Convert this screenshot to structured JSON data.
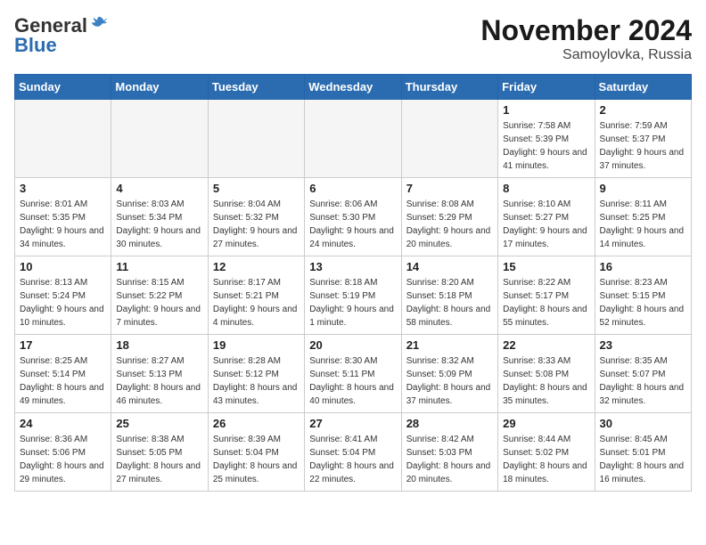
{
  "header": {
    "logo_general": "General",
    "logo_blue": "Blue",
    "month_title": "November 2024",
    "location": "Samoylovka, Russia"
  },
  "weekdays": [
    "Sunday",
    "Monday",
    "Tuesday",
    "Wednesday",
    "Thursday",
    "Friday",
    "Saturday"
  ],
  "weeks": [
    [
      {
        "day": "",
        "empty": true
      },
      {
        "day": "",
        "empty": true
      },
      {
        "day": "",
        "empty": true
      },
      {
        "day": "",
        "empty": true
      },
      {
        "day": "",
        "empty": true
      },
      {
        "day": "1",
        "sunrise": "7:58 AM",
        "sunset": "5:39 PM",
        "daylight": "9 hours and 41 minutes."
      },
      {
        "day": "2",
        "sunrise": "7:59 AM",
        "sunset": "5:37 PM",
        "daylight": "9 hours and 37 minutes."
      }
    ],
    [
      {
        "day": "3",
        "sunrise": "8:01 AM",
        "sunset": "5:35 PM",
        "daylight": "9 hours and 34 minutes."
      },
      {
        "day": "4",
        "sunrise": "8:03 AM",
        "sunset": "5:34 PM",
        "daylight": "9 hours and 30 minutes."
      },
      {
        "day": "5",
        "sunrise": "8:04 AM",
        "sunset": "5:32 PM",
        "daylight": "9 hours and 27 minutes."
      },
      {
        "day": "6",
        "sunrise": "8:06 AM",
        "sunset": "5:30 PM",
        "daylight": "9 hours and 24 minutes."
      },
      {
        "day": "7",
        "sunrise": "8:08 AM",
        "sunset": "5:29 PM",
        "daylight": "9 hours and 20 minutes."
      },
      {
        "day": "8",
        "sunrise": "8:10 AM",
        "sunset": "5:27 PM",
        "daylight": "9 hours and 17 minutes."
      },
      {
        "day": "9",
        "sunrise": "8:11 AM",
        "sunset": "5:25 PM",
        "daylight": "9 hours and 14 minutes."
      }
    ],
    [
      {
        "day": "10",
        "sunrise": "8:13 AM",
        "sunset": "5:24 PM",
        "daylight": "9 hours and 10 minutes."
      },
      {
        "day": "11",
        "sunrise": "8:15 AM",
        "sunset": "5:22 PM",
        "daylight": "9 hours and 7 minutes."
      },
      {
        "day": "12",
        "sunrise": "8:17 AM",
        "sunset": "5:21 PM",
        "daylight": "9 hours and 4 minutes."
      },
      {
        "day": "13",
        "sunrise": "8:18 AM",
        "sunset": "5:19 PM",
        "daylight": "9 hours and 1 minute."
      },
      {
        "day": "14",
        "sunrise": "8:20 AM",
        "sunset": "5:18 PM",
        "daylight": "8 hours and 58 minutes."
      },
      {
        "day": "15",
        "sunrise": "8:22 AM",
        "sunset": "5:17 PM",
        "daylight": "8 hours and 55 minutes."
      },
      {
        "day": "16",
        "sunrise": "8:23 AM",
        "sunset": "5:15 PM",
        "daylight": "8 hours and 52 minutes."
      }
    ],
    [
      {
        "day": "17",
        "sunrise": "8:25 AM",
        "sunset": "5:14 PM",
        "daylight": "8 hours and 49 minutes."
      },
      {
        "day": "18",
        "sunrise": "8:27 AM",
        "sunset": "5:13 PM",
        "daylight": "8 hours and 46 minutes."
      },
      {
        "day": "19",
        "sunrise": "8:28 AM",
        "sunset": "5:12 PM",
        "daylight": "8 hours and 43 minutes."
      },
      {
        "day": "20",
        "sunrise": "8:30 AM",
        "sunset": "5:11 PM",
        "daylight": "8 hours and 40 minutes."
      },
      {
        "day": "21",
        "sunrise": "8:32 AM",
        "sunset": "5:09 PM",
        "daylight": "8 hours and 37 minutes."
      },
      {
        "day": "22",
        "sunrise": "8:33 AM",
        "sunset": "5:08 PM",
        "daylight": "8 hours and 35 minutes."
      },
      {
        "day": "23",
        "sunrise": "8:35 AM",
        "sunset": "5:07 PM",
        "daylight": "8 hours and 32 minutes."
      }
    ],
    [
      {
        "day": "24",
        "sunrise": "8:36 AM",
        "sunset": "5:06 PM",
        "daylight": "8 hours and 29 minutes."
      },
      {
        "day": "25",
        "sunrise": "8:38 AM",
        "sunset": "5:05 PM",
        "daylight": "8 hours and 27 minutes."
      },
      {
        "day": "26",
        "sunrise": "8:39 AM",
        "sunset": "5:04 PM",
        "daylight": "8 hours and 25 minutes."
      },
      {
        "day": "27",
        "sunrise": "8:41 AM",
        "sunset": "5:04 PM",
        "daylight": "8 hours and 22 minutes."
      },
      {
        "day": "28",
        "sunrise": "8:42 AM",
        "sunset": "5:03 PM",
        "daylight": "8 hours and 20 minutes."
      },
      {
        "day": "29",
        "sunrise": "8:44 AM",
        "sunset": "5:02 PM",
        "daylight": "8 hours and 18 minutes."
      },
      {
        "day": "30",
        "sunrise": "8:45 AM",
        "sunset": "5:01 PM",
        "daylight": "8 hours and 16 minutes."
      }
    ]
  ]
}
